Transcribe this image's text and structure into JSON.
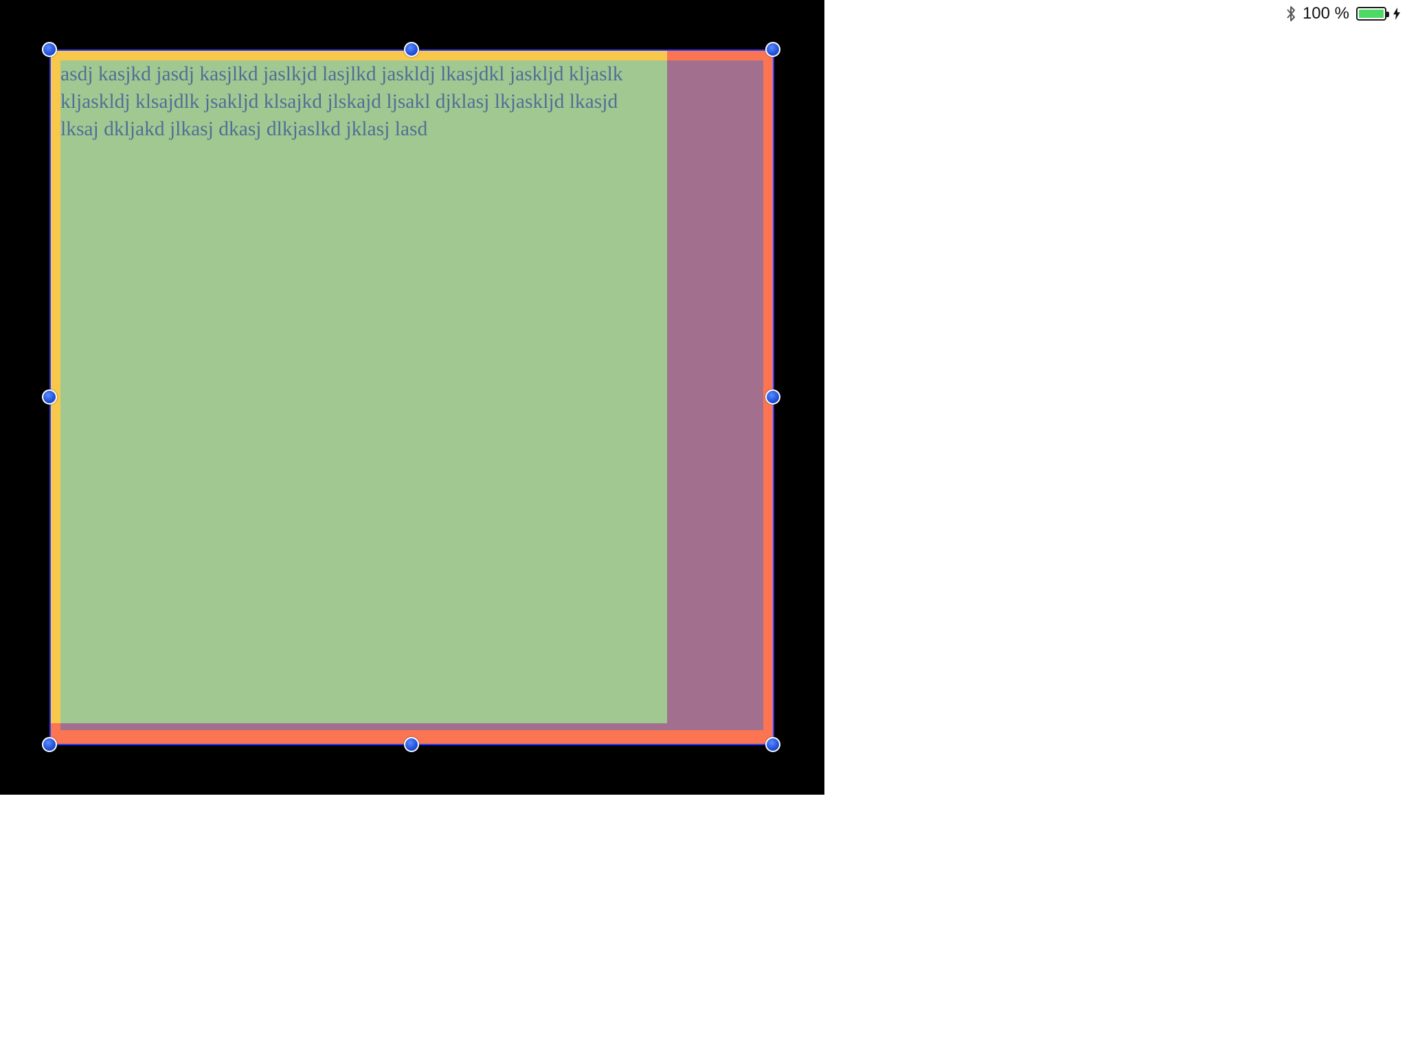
{
  "status_bar": {
    "bluetooth_icon": "bluetooth-icon",
    "battery_percent": "100 %",
    "battery_level": 1.0,
    "battery_color": "#4cd964",
    "charging_icon": "bolt-icon"
  },
  "canvas": {
    "text_lines": [
      "asdj kasjkd jasdj kasjlkd jaslkjd lasjlkd jaskldj lkasjdkl jaskljd kljaslk",
      "kljaskldj klsajdlk jsakljd klsajkd jlskajd ljsakl djklasj lkjaskljd lkasjd",
      "lksaj dkljakd jlkasj dkasj dlkjaslkd jklasj lasd"
    ],
    "colors": {
      "background": "#000000",
      "text_view": "#a2c891",
      "container": "#f8c84c",
      "overlay": "#a26f8e",
      "inset": "#fb7552",
      "selection": "#2b3bff",
      "text": "#4f6f96"
    }
  }
}
